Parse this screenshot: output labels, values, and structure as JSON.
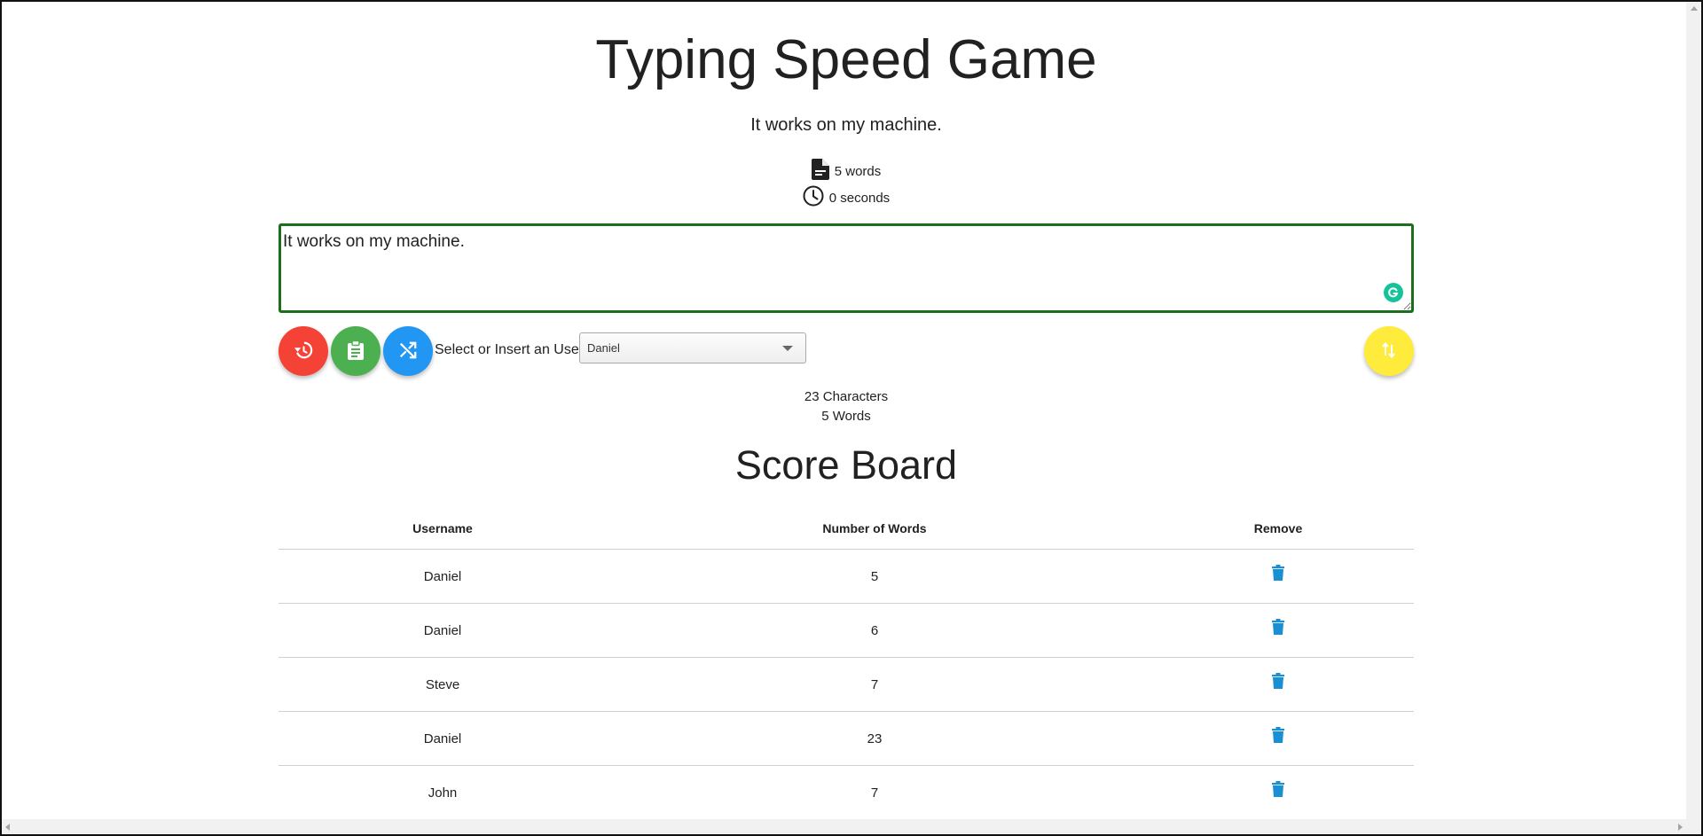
{
  "header": {
    "title": "Typing Speed Game"
  },
  "prompt": {
    "sentence": "It works on my machine.",
    "word_count": "5 words",
    "time_elapsed": "0 seconds",
    "word_icon": "document-icon",
    "time_icon": "clock-icon"
  },
  "input": {
    "value": "It works on my machine.",
    "border_color": "#1b6e1b"
  },
  "controls": {
    "reset_icon": "history-icon",
    "clipboard_icon": "clipboard-icon",
    "shuffle_icon": "shuffle-icon",
    "sort_icon": "sort-icon",
    "select_label": "Select or Insert an User:",
    "selected_user": "Daniel",
    "colors": {
      "reset": "#f44336",
      "clipboard": "#4caf50",
      "shuffle": "#2196f3",
      "sort": "#ffeb3b"
    }
  },
  "counts": {
    "characters": "23 Characters",
    "words": "5 Words"
  },
  "scoreboard": {
    "title": "Score Board",
    "headers": {
      "username": "Username",
      "words": "Number of Words",
      "remove": "Remove"
    },
    "rows": [
      {
        "username": "Daniel",
        "words": "5"
      },
      {
        "username": "Daniel",
        "words": "6"
      },
      {
        "username": "Steve",
        "words": "7"
      },
      {
        "username": "Daniel",
        "words": "23"
      },
      {
        "username": "John",
        "words": "7"
      }
    ],
    "trash_icon": "trash-icon",
    "trash_color": "#1a8fd1"
  }
}
